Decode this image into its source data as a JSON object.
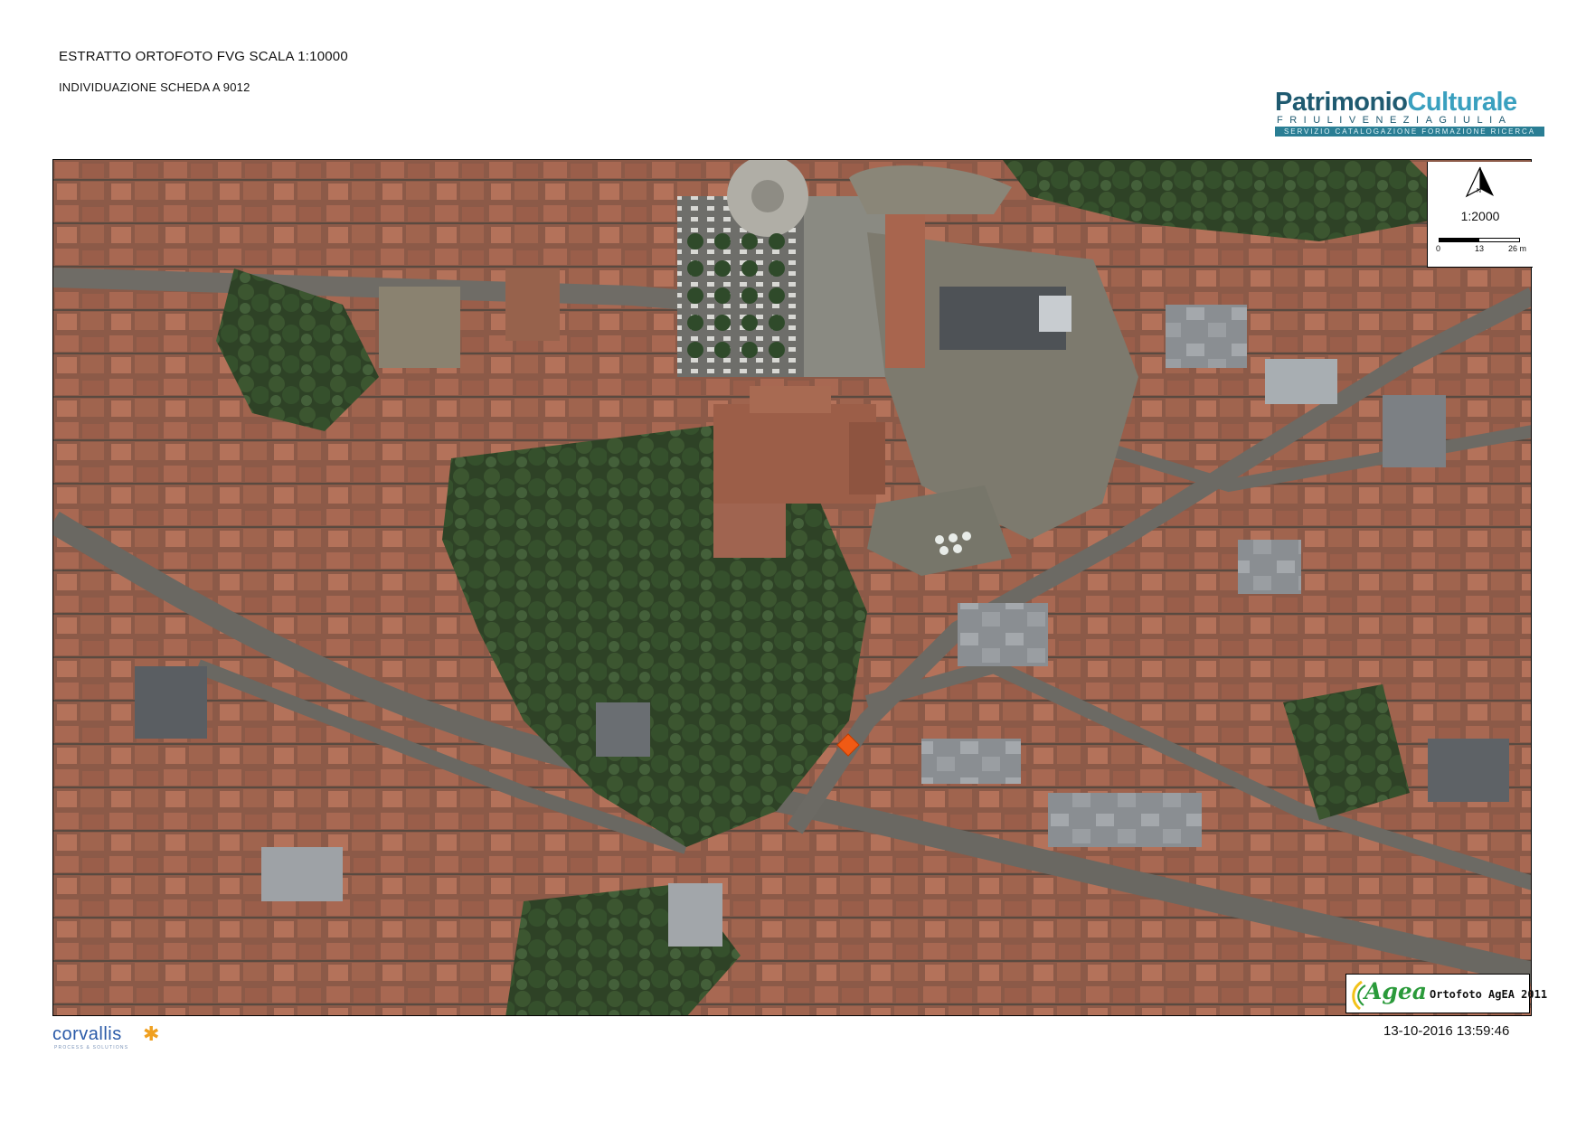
{
  "header": {
    "title": "ESTRATTO ORTOFOTO FVG SCALA 1:10000",
    "subtitle": "INDIVIDUAZIONE SCHEDA A 9012"
  },
  "logo_patrimonio": {
    "brand_part1": "Patrimonio",
    "brand_part2": "Culturale",
    "region": "FRIULIVENEZIAGIULIA",
    "service": "SERVIZIO CATALOGAZIONE FORMAZIONE RICERCA",
    "colors": {
      "dark": "#1f5a70",
      "light": "#3aa0bf"
    }
  },
  "map": {
    "type": "orthophoto",
    "marker": {
      "shape": "diamond",
      "color": "#f05a14"
    },
    "north_arrow": {
      "letter": "N"
    },
    "scale": {
      "ratio": "1:2000",
      "ticks": [
        "0",
        "13",
        "26 m"
      ]
    }
  },
  "agea_logo": {
    "mark": "Agea",
    "caption": "Ortofoto AgEA 2011"
  },
  "corvallis_logo": {
    "word": "corvallis",
    "tagline": "PROCESS & SOLUTIONS"
  },
  "timestamp": "13-10-2016 13:59:46"
}
